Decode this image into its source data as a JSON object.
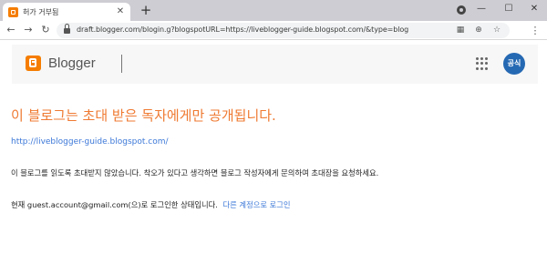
{
  "browser": {
    "tab_title": "허가 거부됨",
    "new_tab_symbol": "+",
    "url": "draft.blogger.com/blogin.g?blogspotURL=https://liveblogger-guide.blogspot.com/&type=blog",
    "window_controls": {
      "minimize": "—",
      "maximize": "☐",
      "close": "✕"
    }
  },
  "header": {
    "brand_name": "Blogger",
    "avatar_label": "공식"
  },
  "main": {
    "heading": "이 블로그는 초대 받은 독자에게만 공개됩니다.",
    "blog_url": "http://liveblogger-guide.blogspot.com/",
    "message": "이 블로그를 읽도록 초대받지 않았습니다. 착오가 있다고 생각하면 블로그 작성자에게 문의하여 초대장을 요청하세요.",
    "status_prefix": "현재",
    "account": "guest.account@gmail.com",
    "status_suffix": "(으)로 로그인한 상태입니다.",
    "switch_account": "다른 계정으로 로그인"
  },
  "colors": {
    "heading": "#ef7a32",
    "link": "#3c78d8",
    "blogger_orange": "#f57d00",
    "avatar": "#2569b3"
  },
  "icons": [
    "back-arrow-icon",
    "forward-arrow-icon",
    "reload-icon",
    "lock-icon",
    "qr-code-icon",
    "zoom-icon",
    "bookmark-star-icon",
    "menu-dots-icon",
    "apps-grid-icon",
    "profile-icon"
  ]
}
